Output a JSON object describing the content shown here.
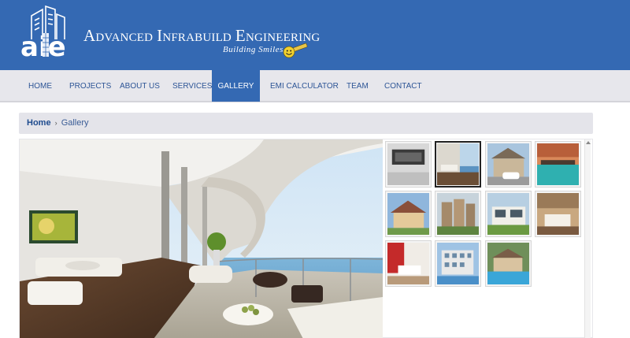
{
  "brand": {
    "logo_text": "aie",
    "title_A": "A",
    "title_dvanced": "DVANCED",
    "title_I": "I",
    "title_nfrabuild": "NFRABUILD",
    "title_E": "E",
    "title_ngineering": "NGINEERING",
    "tagline": "Building Smiles"
  },
  "nav": {
    "items": [
      {
        "label": "HOME"
      },
      {
        "label": "PROJECTS"
      },
      {
        "label": "ABOUT US"
      },
      {
        "label": "SERVICES"
      },
      {
        "label": "GALLERY"
      },
      {
        "label": "EMI CALCULATOR"
      },
      {
        "label": "TEAM"
      },
      {
        "label": "CONTACT"
      }
    ],
    "active": "GALLERY"
  },
  "breadcrumb": {
    "home": "Home",
    "separator": "›",
    "current": "Gallery"
  },
  "gallery": {
    "main_image": "living-room-balcony-sea-view",
    "selected_thumb": 2,
    "thumbs": [
      "kitchen-interior",
      "living-room-balcony",
      "house-with-car",
      "pool-at-dusk",
      "suburban-house",
      "apartment-complex",
      "modern-villa",
      "bedroom-interior",
      "red-bedroom",
      "residential-building",
      "house-with-pool"
    ]
  },
  "colors": {
    "header_blue": "#3469b3",
    "nav_bg": "#e7e7ec",
    "nav_text": "#2d5596",
    "breadcrumb_bg": "#e4e4ea"
  }
}
